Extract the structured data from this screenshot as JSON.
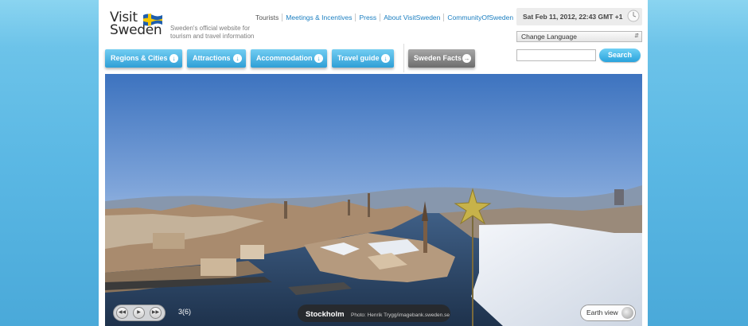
{
  "logo": {
    "line1": "Visit",
    "line2": "Sweden"
  },
  "tagline": "Sweden's official website for tourism and travel information",
  "topnav": [
    "Tourists",
    "Meetings & Incentives",
    "Press",
    "About VisitSweden",
    "CommunityOfSweden"
  ],
  "datetime": "Sat Feb 11, 2012, 22:43 GMT +1",
  "language": {
    "selected": "Change Language"
  },
  "search": {
    "button_label": "Search",
    "value": ""
  },
  "mainnav": [
    {
      "label": "Regions & Cities"
    },
    {
      "label": "Attractions"
    },
    {
      "label": "Accommodation"
    },
    {
      "label": "Travel guide"
    },
    {
      "label": "Sweden Facts"
    }
  ],
  "hero": {
    "counter": "3(6)",
    "city": "Stockholm",
    "credit": "Photo: Henrik Trygg/imagebank.sweden.se",
    "earth_label": "Earth view"
  },
  "colors": {
    "accent": "#2f9fd6",
    "flag_blue": "#1f5fae",
    "flag_yellow": "#f6c800"
  }
}
